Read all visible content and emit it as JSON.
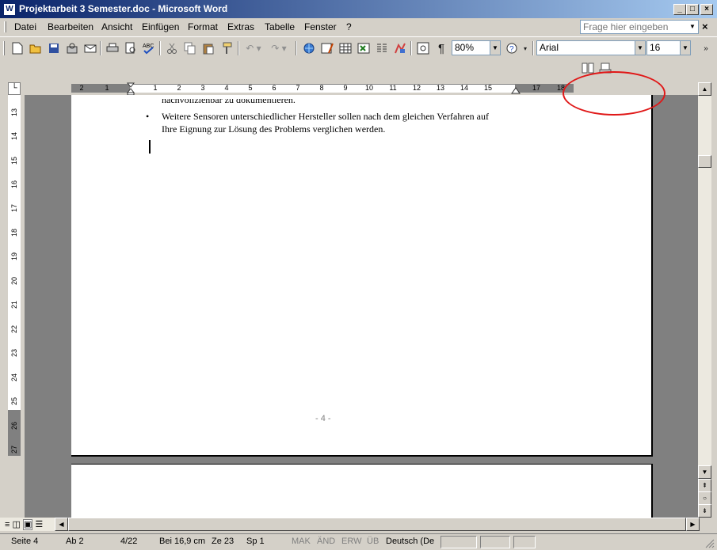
{
  "window": {
    "title": "Projektarbeit 3 Semester.doc - Microsoft Word",
    "app_icon": "W"
  },
  "window_buttons": {
    "minimize": "_",
    "maximize": "□",
    "close": "×"
  },
  "menu": {
    "items": [
      "Datei",
      "Bearbeiten",
      "Ansicht",
      "Einfügen",
      "Format",
      "Extras",
      "Tabelle",
      "Fenster",
      "?"
    ],
    "help_placeholder": "Frage hier eingeben",
    "close": "×"
  },
  "toolbar": {
    "zoom": "80%",
    "font": "Arial",
    "font_size": "16",
    "pilcrow": "¶",
    "icons": [
      "new-icon",
      "open-icon",
      "save-icon",
      "permission-icon",
      "email-icon",
      "print-icon",
      "print-preview-icon",
      "spelling-icon",
      "cut-icon",
      "copy-icon",
      "paste-icon",
      "format-painter-icon",
      "undo-icon",
      "redo-icon",
      "hyperlink-icon",
      "tables-borders-icon",
      "insert-table-icon",
      "insert-excel-icon",
      "columns-icon",
      "drawing-icon",
      "document-map-icon",
      "show-hide-icon",
      "zoom-icon",
      "help-icon"
    ]
  },
  "ruler": {
    "h_left_numbers": [
      "2",
      "1"
    ],
    "h_numbers": [
      "1",
      "2",
      "3",
      "4",
      "5",
      "6",
      "7",
      "8",
      "9",
      "10",
      "11",
      "12",
      "13",
      "14",
      "15"
    ],
    "h_right_numbers": [
      "17",
      "18"
    ],
    "v_numbers": [
      "13",
      "14",
      "15",
      "16",
      "17",
      "18",
      "19",
      "20",
      "21",
      "22",
      "23",
      "24",
      "25",
      "26",
      "27"
    ]
  },
  "document": {
    "line_partial": "nachvollziehbar zu dokumentieren.",
    "bullet": "•",
    "bullet_line1": "Weitere Sensoren unterschiedlicher Hersteller sollen nach dem gleichen Verfahren auf",
    "bullet_line2": "Ihre Eignung zur Lösung des Problems verglichen werden.",
    "page_number": "- 4 -"
  },
  "status": {
    "page": "Seite 4",
    "section": "Ab 2",
    "pages": "4/22",
    "position": "Bei 16,9 cm",
    "line": "Ze 23",
    "column": "Sp 1",
    "rec": "MAK",
    "trk": "ÄND",
    "ext": "ERW",
    "ovr": "ÜB",
    "language": "Deutsch (De"
  },
  "colors": {
    "title_start": "#0a246a",
    "title_end": "#a6caf0",
    "annotation": "#e01818"
  }
}
